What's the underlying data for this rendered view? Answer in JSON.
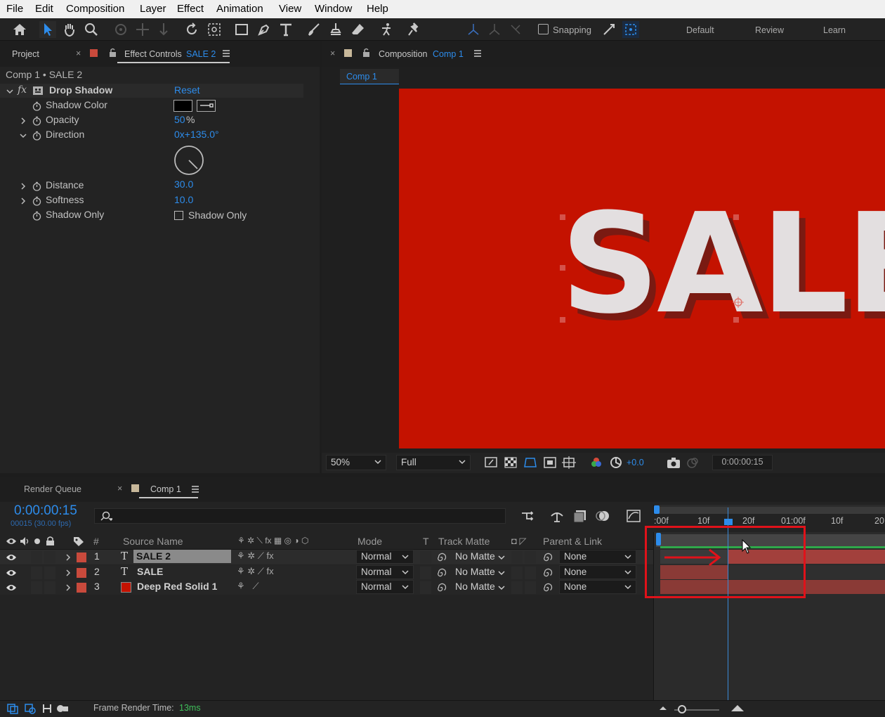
{
  "menu": [
    "File",
    "Edit",
    "Composition",
    "Layer",
    "Effect",
    "Animation",
    "View",
    "Window",
    "Help"
  ],
  "toolbar": {
    "snapping_label": "Snapping",
    "workspaces": [
      "Default",
      "Review",
      "Learn"
    ]
  },
  "left_panel": {
    "project_tab": "Project",
    "effect_controls_tab": "Effect Controls",
    "effect_controls_layer": "SALE 2",
    "breadcrumb": "Comp 1 • SALE 2",
    "effect": {
      "name": "Drop Shadow",
      "reset_label": "Reset",
      "fx_label": "fx",
      "properties": {
        "shadow_color": "Shadow Color",
        "opacity": "Opacity",
        "opacity_value": "50",
        "opacity_unit": "%",
        "direction": "Direction",
        "direction_value": "0x+135.0°",
        "distance": "Distance",
        "distance_value": "30.0",
        "softness": "Softness",
        "softness_value": "10.0",
        "shadow_only": "Shadow Only",
        "shadow_only_checkbox": "Shadow Only"
      }
    }
  },
  "comp_panel": {
    "tab_label": "Composition",
    "tab_comp": "Comp 1",
    "sub_tab": "Comp 1",
    "canvas_text": "SALE",
    "bg_color": "#c41200",
    "zoom": "50%",
    "resolution": "Full",
    "exposure": "+0.0",
    "timecode": "0:00:00:15"
  },
  "timeline": {
    "render_queue_tab": "Render Queue",
    "comp_tab": "Comp 1",
    "timecode": "0:00:00:15",
    "frame_info": "00015 (30.00 fps)",
    "columns": {
      "hash": "#",
      "source_name": "Source Name",
      "mode": "Mode",
      "t": "T",
      "track_matte": "Track Matte",
      "parent": "Parent & Link"
    },
    "ruler": [
      ":00f",
      "10f",
      "20f",
      "01:00f",
      "10f",
      "20"
    ],
    "layers": [
      {
        "num": "1",
        "type": "T",
        "name": "SALE 2",
        "mode": "Normal",
        "matte": "No Matte",
        "parent": "None"
      },
      {
        "num": "2",
        "type": "T",
        "name": "SALE",
        "mode": "Normal",
        "matte": "No Matte",
        "parent": "None"
      },
      {
        "num": "3",
        "type": "",
        "name": "Deep Red Solid 1",
        "mode": "Normal",
        "matte": "No Matte",
        "parent": "None"
      }
    ],
    "footer_label": "Frame Render Time:",
    "footer_value": "13ms"
  },
  "colors": {
    "accent": "#2d8ceb",
    "label_red": "#c94a3c",
    "layer_bar": "#8a3a36",
    "highlight_box": "#e0121a"
  }
}
